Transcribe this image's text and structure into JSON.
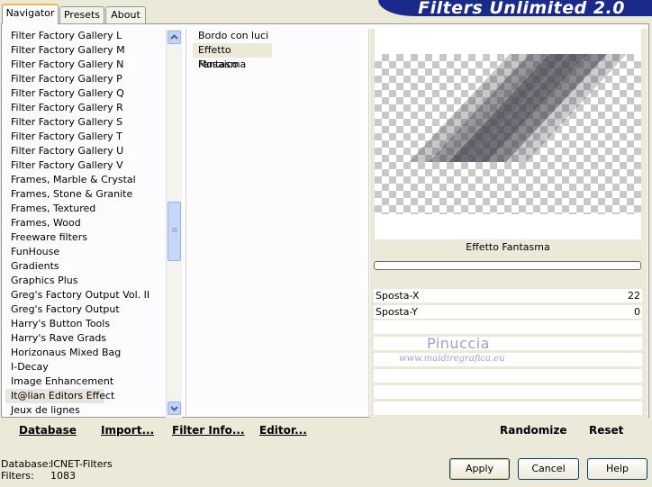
{
  "app_title": "Filters Unlimited 2.0",
  "tabs": [
    {
      "label": "Navigator",
      "active": true
    },
    {
      "label": "Presets",
      "active": false
    },
    {
      "label": "About",
      "active": false
    }
  ],
  "categories": [
    "Filter Factory Gallery L",
    "Filter Factory Gallery M",
    "Filter Factory Gallery N",
    "Filter Factory Gallery P",
    "Filter Factory Gallery Q",
    "Filter Factory Gallery R",
    "Filter Factory Gallery S",
    "Filter Factory Gallery T",
    "Filter Factory Gallery U",
    "Filter Factory Gallery V",
    "Frames, Marble & Crystal",
    "Frames, Stone & Granite",
    "Frames, Textured",
    "Frames, Wood",
    "Freeware filters",
    "FunHouse",
    "Gradients",
    "Graphics Plus",
    "Greg's Factory Output Vol. II",
    "Greg's Factory Output",
    "Harry's Button Tools",
    "Harry's Rave Grads",
    "Horizonaus Mixed Bag",
    "I-Decay",
    "Image Enhancement",
    "It@lian Editors Effect",
    "Jeux de lignes"
  ],
  "selected_category": "It@lian Editors Effect",
  "filters": [
    "Bordo con luci",
    "Effetto Fantasma",
    "Mosaico"
  ],
  "selected_filter": "Effetto Fantasma",
  "preview": {
    "filter_name": "Effetto Fantasma"
  },
  "params": [
    {
      "label": "Sposta-X",
      "value": "22"
    },
    {
      "label": "Sposta-Y",
      "value": "0"
    }
  ],
  "watermark": {
    "name": "Pinuccia",
    "url": "www.maidiregrafica.eu"
  },
  "bottom_links": {
    "database": "Database",
    "import": "Import...",
    "filter_info": "Filter Info...",
    "editor": "Editor...",
    "randomize": "Randomize",
    "reset": "Reset"
  },
  "status": {
    "database_label": "Database:",
    "database_value": "ICNET-Filters",
    "filters_label": "Filters:",
    "filters_value": "1083"
  },
  "buttons": {
    "apply": "Apply",
    "cancel": "Cancel",
    "help": "Help"
  },
  "colors": {
    "banner": "#1a2a8a",
    "accent": "#f7b54b",
    "face": "#ece9d8"
  }
}
